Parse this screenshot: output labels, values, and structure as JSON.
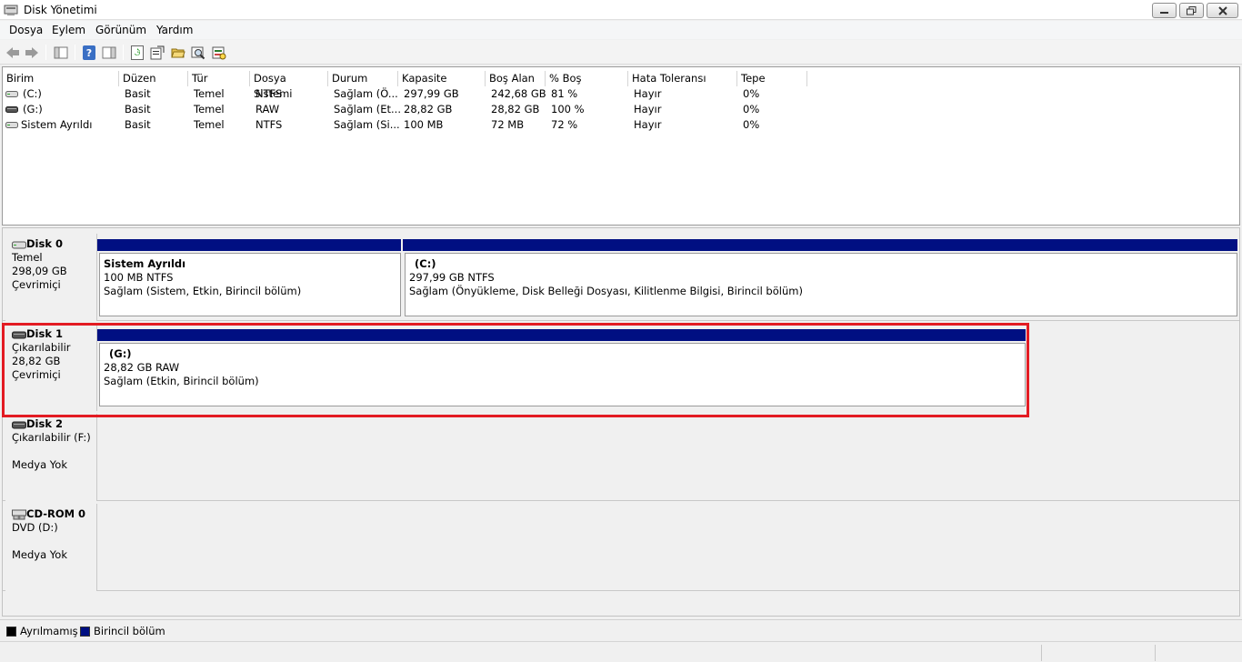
{
  "window": {
    "title": "Disk Yönetimi",
    "icons": [
      "app-icon",
      "minimize-icon",
      "maximize-icon",
      "close-icon"
    ]
  },
  "menu": [
    "Dosya",
    "Eylem",
    "Görünüm",
    "Yardım"
  ],
  "toolbar": {
    "icons": [
      "back-arrow-icon",
      "forward-arrow-icon",
      "show-hide-tree-icon",
      "help-icon",
      "show-hide-action-icon",
      "refresh-icon",
      "properties-icon",
      "open-folder-icon",
      "explore-icon",
      "rescan-disks-icon"
    ]
  },
  "volume_list": {
    "columns": [
      "Birim",
      "Düzen",
      "Tür",
      "Dosya Sistemi",
      "Durum",
      "Kapasite",
      "Boş Alan",
      "% Boş",
      "Hata Toleransı",
      "Tepe"
    ],
    "rows": [
      [
        "(C:)",
        "Basit",
        "Temel",
        "NTFS",
        "Sağlam (Ö...",
        "297,99 GB",
        "242,68 GB",
        "81 %",
        "Hayır",
        "0%"
      ],
      [
        "(G:)",
        "Basit",
        "Temel",
        "RAW",
        "Sağlam (Et...",
        "28,82 GB",
        "28,82 GB",
        "100 %",
        "Hayır",
        "0%"
      ],
      [
        "Sistem Ayrıldı",
        "Basit",
        "Temel",
        "NTFS",
        "Sağlam (Si...",
        "100 MB",
        "72 MB",
        "72 %",
        "Hayır",
        "0%"
      ]
    ]
  },
  "disks": [
    {
      "name": "Disk 0",
      "type": "Temel",
      "size": "298,09 GB",
      "status": "Çevrimiçi",
      "partitions": [
        {
          "name": "Sistem Ayrıldı",
          "size": "100 MB NTFS",
          "status": "Sağlam (Sistem, Etkin, Birincil bölüm)"
        },
        {
          "name": "(C:)",
          "size": "297,99 GB NTFS",
          "status": "Sağlam (Önyükleme, Disk Belleği Dosyası, Kilitlenme Bilgisi, Birincil bölüm)"
        }
      ]
    },
    {
      "name": "Disk 1",
      "type": "Çıkarılabilir",
      "size": "28,82 GB",
      "status": "Çevrimiçi",
      "partitions": [
        {
          "name": "(G:)",
          "size": "28,82 GB RAW",
          "status": "Sağlam (Etkin, Birincil bölüm)"
        }
      ]
    },
    {
      "name": "Disk 2",
      "type": "Çıkarılabilir (F:)",
      "status": "Medya Yok"
    },
    {
      "name": "CD-ROM 0",
      "type": "DVD (D:)",
      "status": "Medya Yok"
    }
  ],
  "legend": [
    {
      "label": "Ayrılmamış",
      "color": "#000000"
    },
    {
      "label": "Birincil bölüm",
      "color": "#000f82"
    }
  ],
  "colors": {
    "primary_partition": "#000f82",
    "highlight": "#e31b23"
  }
}
